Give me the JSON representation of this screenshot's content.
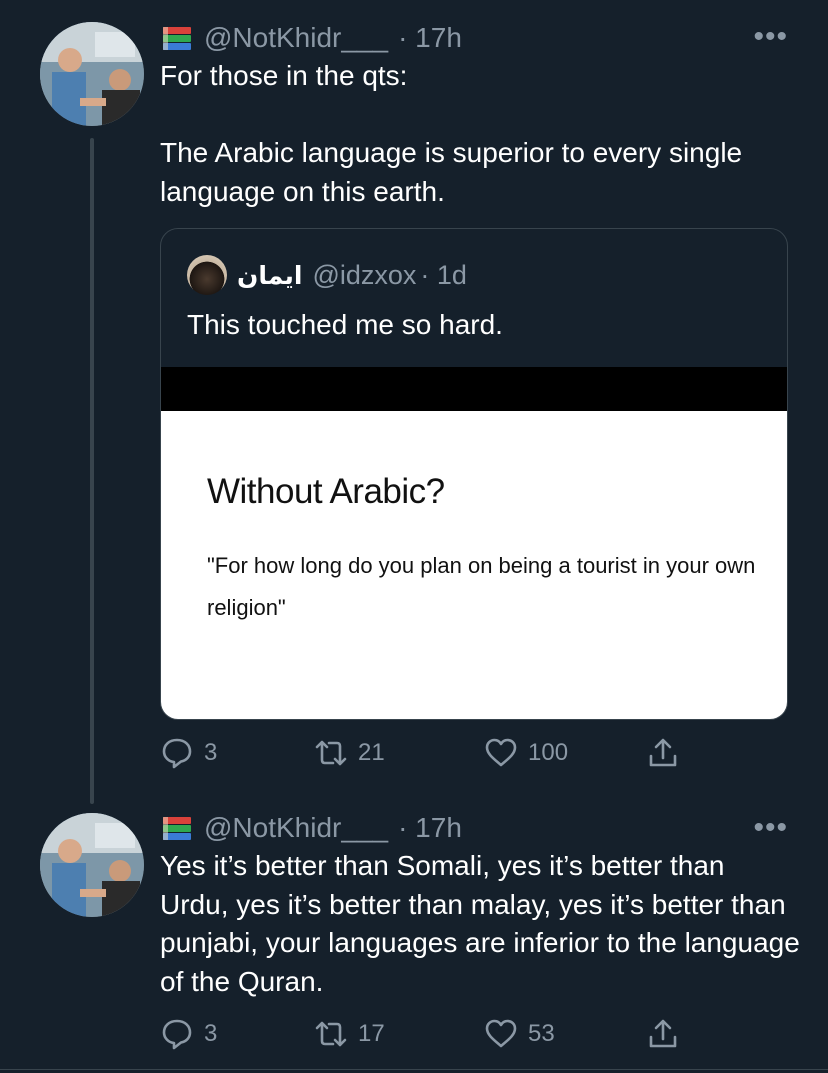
{
  "tweets": [
    {
      "handle": "@NotKhidr___",
      "time": "· 17h",
      "text": "For those in the qts:\n\nThe Arabic language is superior to every single language on this earth.",
      "quote": {
        "name": "ايمان",
        "handle": "@idzxox",
        "time": "· 1d",
        "text": "This touched me so hard.",
        "media_title": "Without Arabic?",
        "media_quote": "\"For how long do you plan on being a tourist in your own religion\""
      },
      "actions": {
        "replies": "3",
        "retweets": "21",
        "likes": "100"
      }
    },
    {
      "handle": "@NotKhidr___",
      "time": "· 17h",
      "text": "Yes it’s better than Somali, yes it’s better than Urdu, yes it’s better than malay, yes it’s better than punjabi, your languages are inferior to the language of the Quran.",
      "actions": {
        "replies": "3",
        "retweets": "17",
        "likes": "53"
      }
    }
  ],
  "icons": {
    "badge": "books-emoji-icon",
    "more": "more-icon",
    "reply": "reply-icon",
    "retweet": "retweet-icon",
    "like": "like-icon",
    "share": "share-icon"
  },
  "colors": {
    "background": "#15202b",
    "secondary_text": "#8b98a5",
    "border": "#38444d"
  }
}
